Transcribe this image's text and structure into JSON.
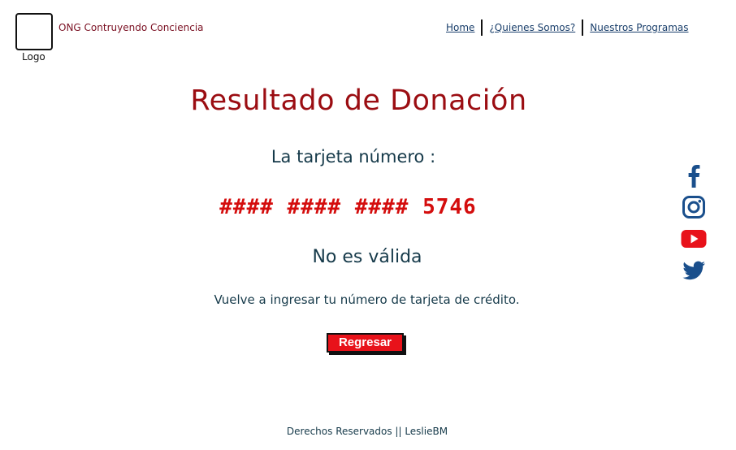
{
  "header": {
    "logo_label": "Logo",
    "org_name": "ONG Contruyendo Conciencia",
    "nav": [
      {
        "label": "Home"
      },
      {
        "label": "¿Quienes Somos?"
      },
      {
        "label": "Nuestros Programas"
      }
    ]
  },
  "main": {
    "title": "Resultado de Donación",
    "subtitle": "La tarjeta número :",
    "card_number": "#### #### #### 5746",
    "status": "No es válida",
    "instruction": "Vuelve a ingresar tu número de tarjeta de crédito.",
    "back_button": "Regresar"
  },
  "social": {
    "icons": [
      "facebook-icon",
      "instagram-icon",
      "youtube-icon",
      "twitter-icon"
    ],
    "colors": {
      "facebook": "#1a4f8c",
      "instagram": "#1a4f8c",
      "youtube": "#e8121a",
      "twitter": "#1a4f8c"
    }
  },
  "footer": {
    "text": "Derechos Reservados || LeslieBM"
  },
  "colors": {
    "title": "#9b0d12",
    "card_number": "#d40d0d",
    "text": "#163a4a",
    "button": "#e8121a"
  }
}
